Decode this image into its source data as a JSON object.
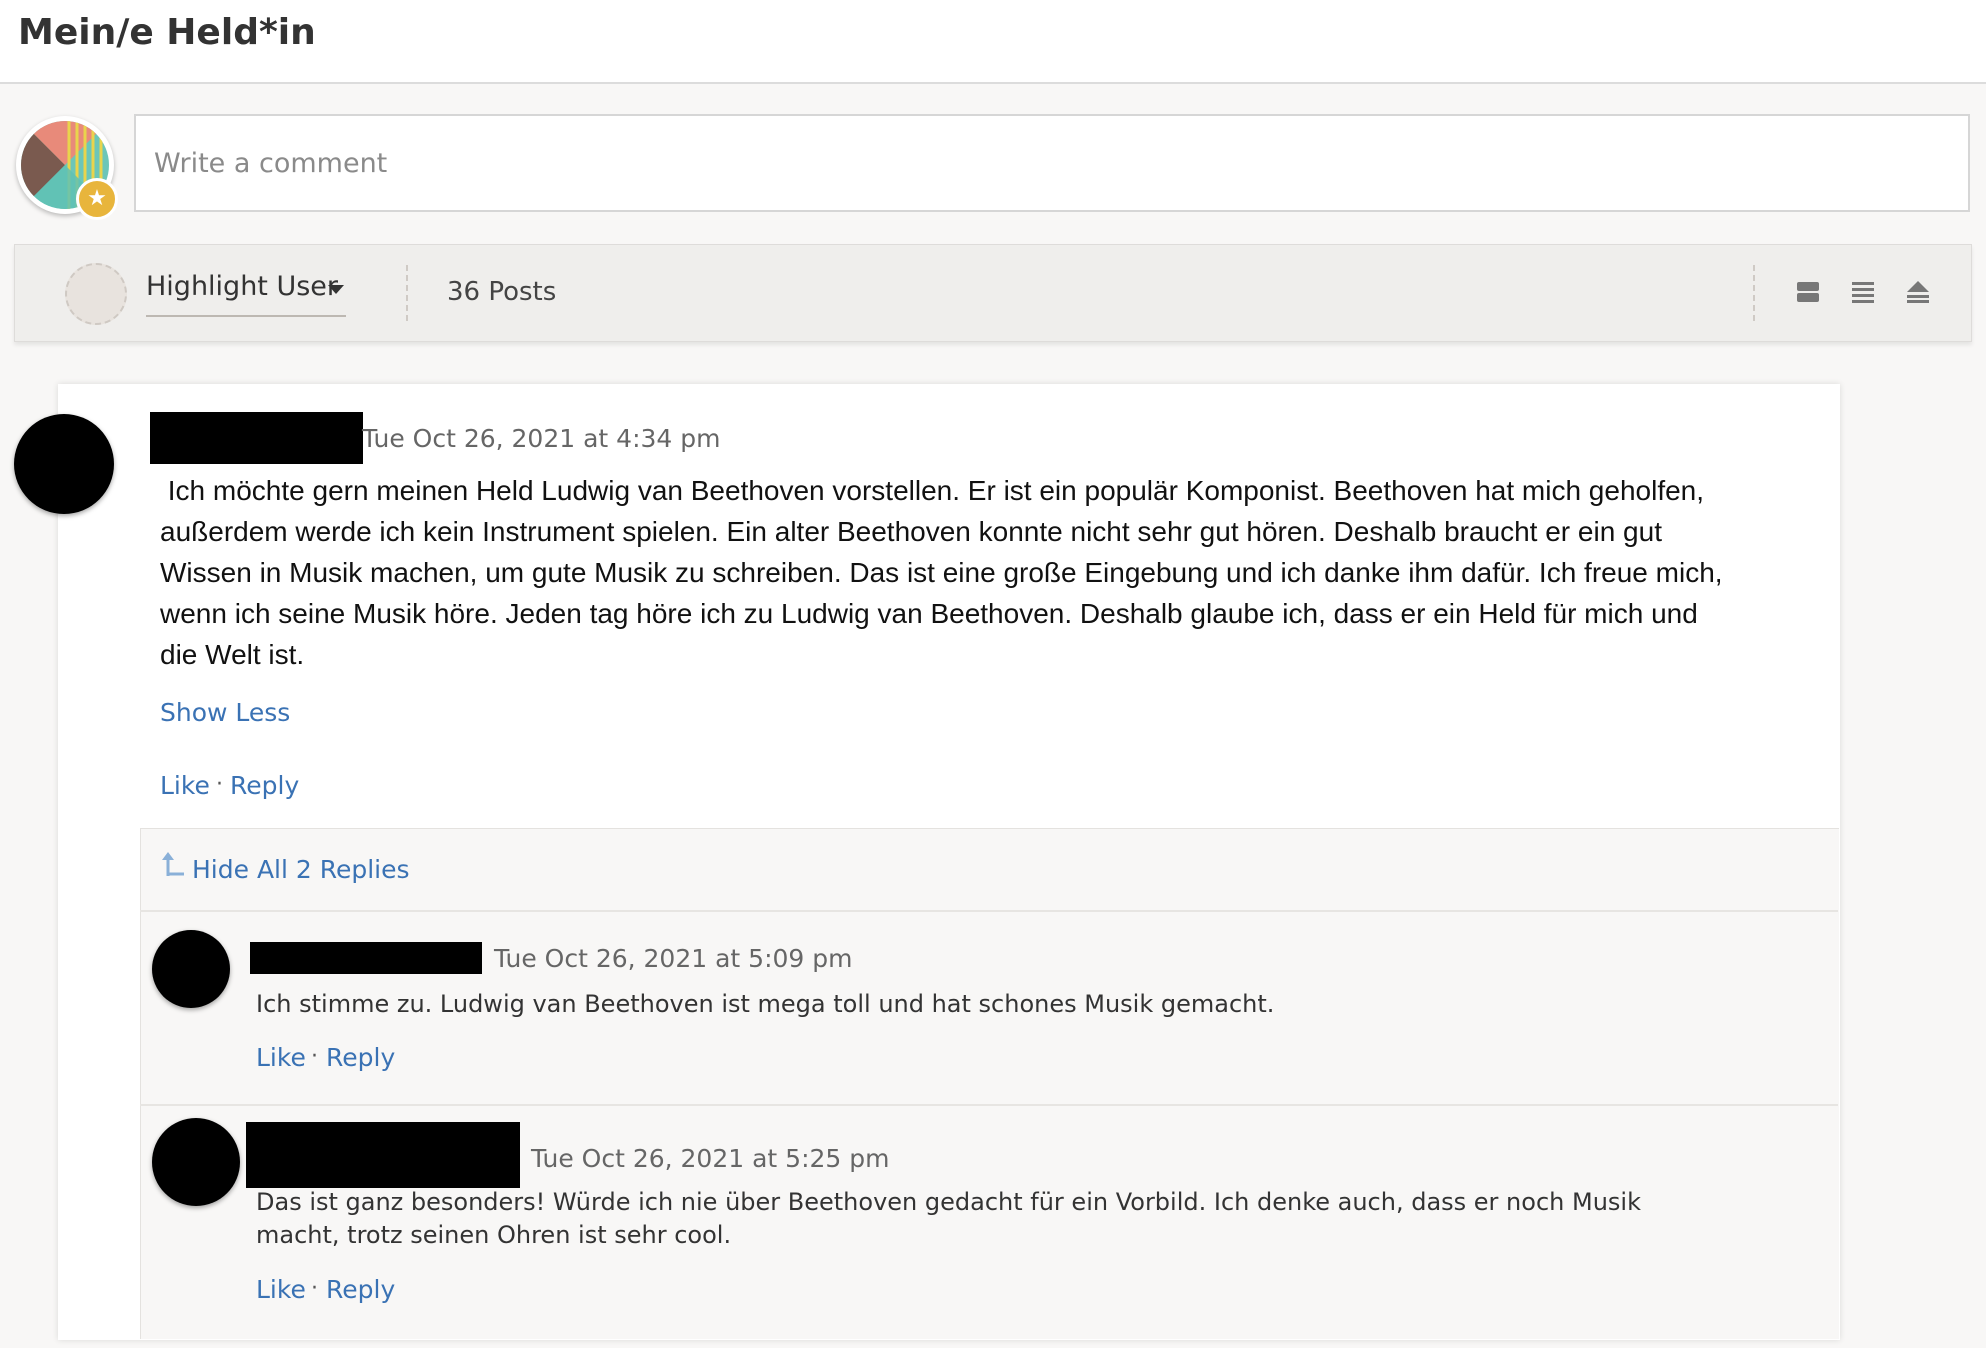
{
  "page": {
    "title": "Mein/e Held*in"
  },
  "composer": {
    "placeholder": "Write a comment"
  },
  "toolbar": {
    "highlight_user_label": "Highlight User",
    "posts_count": "36 Posts",
    "view_icons": [
      "expanded-view-icon",
      "list-view-icon",
      "collapse-icon"
    ]
  },
  "post": {
    "timestamp": "Tue Oct 26, 2021 at 4:34 pm",
    "body": " Ich möchte gern meinen Held Ludwig van Beethoven vorstellen. Er ist ein populär Komponist. Beethoven hat mich geholfen, außerdem werde ich kein Instrument spielen. Ein alter Beethoven konnte nicht sehr gut hören. Deshalb braucht er ein gut Wissen in Musik machen, um gute Musik zu schreiben. Das ist eine große Eingebung und ich danke ihm dafür. Ich freue mich, wenn ich seine Musik höre. Jeden tag höre ich zu Ludwig van Beethoven. Deshalb glaube ich, dass er ein Held für mich und die Welt ist.",
    "show_less": "Show Less",
    "like": "Like",
    "reply": "Reply",
    "separator": "·"
  },
  "replies_toggle": "Hide All 2 Replies",
  "replies": [
    {
      "timestamp": "Tue Oct 26, 2021 at 5:09 pm",
      "body": "Ich stimme zu. Ludwig van Beethoven ist mega toll und hat schones Musik gemacht.",
      "like": "Like",
      "reply": "Reply"
    },
    {
      "timestamp": "Tue Oct 26, 2021 at 5:25 pm",
      "body": "Das ist ganz besonders! Würde ich nie über Beethoven gedacht für ein Vorbild. Ich denke auch, dass er noch Musik macht, trotz seinen Ohren ist sehr cool.",
      "like": "Like",
      "reply": "Reply"
    }
  ],
  "colors": {
    "link": "#3a72b4",
    "star_badge": "#e8b53c",
    "redaction": "#000000"
  }
}
